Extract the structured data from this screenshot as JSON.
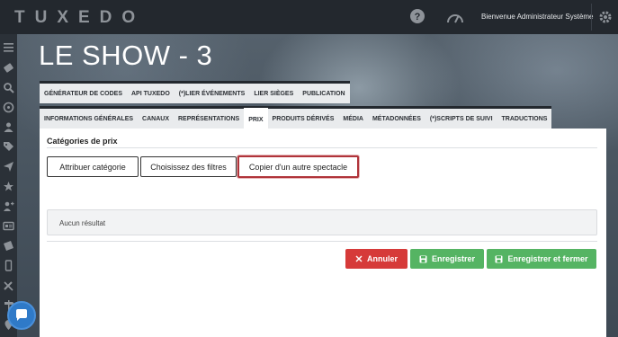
{
  "app": {
    "logo": "TUXEDO"
  },
  "topbar": {
    "welcome": "Bienvenue Administrateur Système",
    "icons": [
      "help-icon",
      "speedometer-icon",
      "gear-icon"
    ]
  },
  "sidebar": {
    "icons": [
      "menu-icon",
      "ticket-icon",
      "search-icon",
      "compass-icon",
      "users-icon",
      "tags-icon",
      "send-icon",
      "star-icon",
      "user-plus-icon",
      "id-card-icon",
      "ticket-alt-icon",
      "mobile-icon",
      "tools-icon",
      "signpost-icon",
      "marker-icon"
    ]
  },
  "page": {
    "title": "LE SHOW - 3"
  },
  "tabs_row1": [
    {
      "label": "GÉNÉRATEUR DE CODES"
    },
    {
      "label": "API TUXEDO"
    },
    {
      "label": "(*)LIER ÉVÉNEMENTS"
    },
    {
      "label": "LIER SIÈGES"
    },
    {
      "label": "PUBLICATION"
    }
  ],
  "tabs_row2": [
    {
      "label": "INFORMATIONS GÉNÉRALES"
    },
    {
      "label": "CANAUX"
    },
    {
      "label": "REPRÉSENTATIONS"
    },
    {
      "label": "PRIX",
      "active": true
    },
    {
      "label": "PRODUITS DÉRIVÉS"
    },
    {
      "label": "MÉDIA"
    },
    {
      "label": "MÉTADONNÉES"
    },
    {
      "label": "(*)SCRIPTS DE SUIVI"
    },
    {
      "label": "TRADUCTIONS"
    }
  ],
  "section": {
    "title": "Catégories de prix",
    "buttons": {
      "assign": "Attribuer catégorie",
      "filters": "Choisissez des filtres",
      "copy": "Copier d'un autre spectacle"
    },
    "empty": "Aucun résultat"
  },
  "actions": {
    "cancel": "Annuler",
    "save": "Enregistrer",
    "save_close": "Enregistrer et fermer"
  },
  "colors": {
    "topbar": "#23282e",
    "cancel": "#d63a39",
    "save": "#55b463",
    "highlight": "#b0343a",
    "chat": "#2f7ac8"
  }
}
